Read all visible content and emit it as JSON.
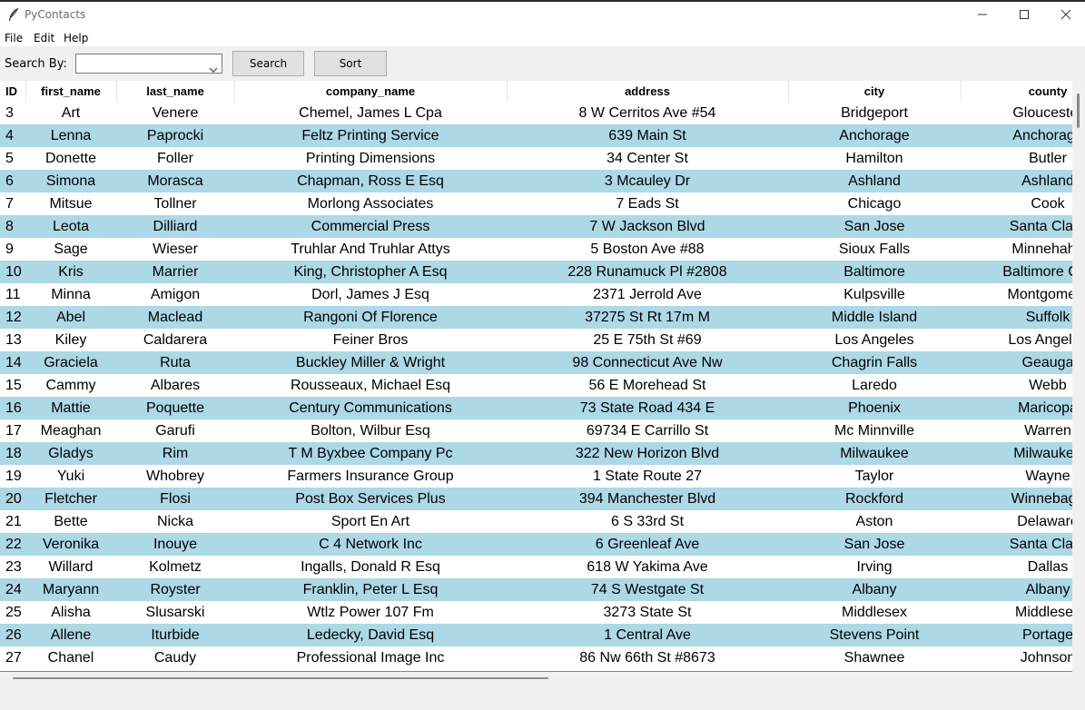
{
  "window": {
    "title": "PyContacts",
    "icon": "feather-icon"
  },
  "menu": [
    "File",
    "Edit",
    "Help"
  ],
  "toolbar": {
    "search_by_label": "Search By:",
    "search_by_value": "",
    "search_button": "Search",
    "sort_button": "Sort"
  },
  "table": {
    "columns": [
      "ID",
      "first_name",
      "last_name",
      "company_name",
      "address",
      "city",
      "county"
    ],
    "rows": [
      [
        "3",
        "Art",
        "Venere",
        "Chemel, James L Cpa",
        "8 W Cerritos Ave #54",
        "Bridgeport",
        "Gloucester"
      ],
      [
        "4",
        "Lenna",
        "Paprocki",
        "Feltz Printing Service",
        "639 Main St",
        "Anchorage",
        "Anchorage"
      ],
      [
        "5",
        "Donette",
        "Foller",
        "Printing Dimensions",
        "34 Center St",
        "Hamilton",
        "Butler"
      ],
      [
        "6",
        "Simona",
        "Morasca",
        "Chapman, Ross E Esq",
        "3 Mcauley Dr",
        "Ashland",
        "Ashland"
      ],
      [
        "7",
        "Mitsue",
        "Tollner",
        "Morlong Associates",
        "7 Eads St",
        "Chicago",
        "Cook"
      ],
      [
        "8",
        "Leota",
        "Dilliard",
        "Commercial Press",
        "7 W Jackson Blvd",
        "San Jose",
        "Santa Clara"
      ],
      [
        "9",
        "Sage",
        "Wieser",
        "Truhlar And Truhlar Attys",
        "5 Boston Ave #88",
        "Sioux Falls",
        "Minnehaha"
      ],
      [
        "10",
        "Kris",
        "Marrier",
        "King, Christopher A Esq",
        "228 Runamuck Pl #2808",
        "Baltimore",
        "Baltimore City"
      ],
      [
        "11",
        "Minna",
        "Amigon",
        "Dorl, James J Esq",
        "2371 Jerrold Ave",
        "Kulpsville",
        "Montgomery"
      ],
      [
        "12",
        "Abel",
        "Maclead",
        "Rangoni Of Florence",
        "37275 St  Rt 17m M",
        "Middle Island",
        "Suffolk"
      ],
      [
        "13",
        "Kiley",
        "Caldarera",
        "Feiner Bros",
        "25 E 75th St #69",
        "Los Angeles",
        "Los Angeles"
      ],
      [
        "14",
        "Graciela",
        "Ruta",
        "Buckley Miller & Wright",
        "98 Connecticut Ave Nw",
        "Chagrin Falls",
        "Geauga"
      ],
      [
        "15",
        "Cammy",
        "Albares",
        "Rousseaux, Michael Esq",
        "56 E Morehead St",
        "Laredo",
        "Webb"
      ],
      [
        "16",
        "Mattie",
        "Poquette",
        "Century Communications",
        "73 State Road 434 E",
        "Phoenix",
        "Maricopa"
      ],
      [
        "17",
        "Meaghan",
        "Garufi",
        "Bolton, Wilbur Esq",
        "69734 E Carrillo St",
        "Mc Minnville",
        "Warren"
      ],
      [
        "18",
        "Gladys",
        "Rim",
        "T M Byxbee Company Pc",
        "322 New Horizon Blvd",
        "Milwaukee",
        "Milwaukee"
      ],
      [
        "19",
        "Yuki",
        "Whobrey",
        "Farmers Insurance Group",
        "1 State Route 27",
        "Taylor",
        "Wayne"
      ],
      [
        "20",
        "Fletcher",
        "Flosi",
        "Post Box Services Plus",
        "394 Manchester Blvd",
        "Rockford",
        "Winnebago"
      ],
      [
        "21",
        "Bette",
        "Nicka",
        "Sport En Art",
        "6 S 33rd St",
        "Aston",
        "Delaware"
      ],
      [
        "22",
        "Veronika",
        "Inouye",
        "C 4 Network Inc",
        "6 Greenleaf Ave",
        "San Jose",
        "Santa Clara"
      ],
      [
        "23",
        "Willard",
        "Kolmetz",
        "Ingalls, Donald R Esq",
        "618 W Yakima Ave",
        "Irving",
        "Dallas"
      ],
      [
        "24",
        "Maryann",
        "Royster",
        "Franklin, Peter L Esq",
        "74 S Westgate St",
        "Albany",
        "Albany"
      ],
      [
        "25",
        "Alisha",
        "Slusarski",
        "Wtlz Power 107 Fm",
        "3273 State St",
        "Middlesex",
        "Middlesex"
      ],
      [
        "26",
        "Allene",
        "Iturbide",
        "Ledecky, David Esq",
        "1 Central Ave",
        "Stevens Point",
        "Portage"
      ],
      [
        "27",
        "Chanel",
        "Caudy",
        "Professional Image Inc",
        "86 Nw 66th St #8673",
        "Shawnee",
        "Johnson"
      ]
    ]
  },
  "colors": {
    "row_even": "#add8e6",
    "row_odd": "#ffffff",
    "window_bg": "#f0f0f0"
  }
}
